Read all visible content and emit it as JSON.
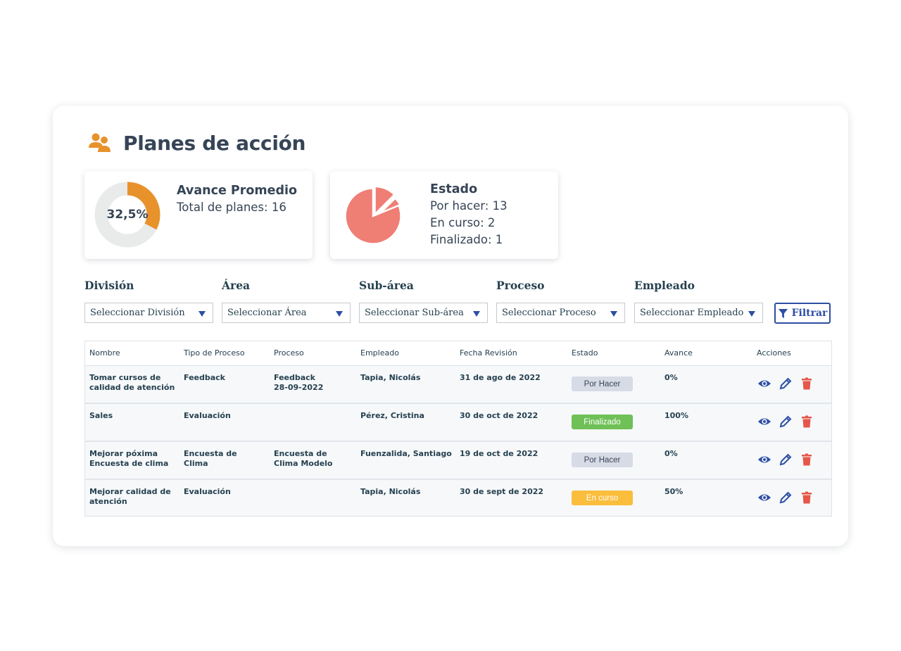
{
  "header": {
    "title": "Planes de acción",
    "icon": "users-icon",
    "accent": "#e8922c"
  },
  "avance": {
    "percent_label": "32,5%",
    "percent": 32.5,
    "title": "Avance Promedio",
    "total": "Total de planes: 16"
  },
  "estado": {
    "title": "Estado",
    "por_hacer": "Por hacer: 13",
    "en_curso": "En curso: 2",
    "finalizado": "Finalizado: 1",
    "counts": {
      "por_hacer": 13,
      "en_curso": 2,
      "finalizado": 1
    },
    "pie_color": "#ef7e74"
  },
  "filters": [
    {
      "label": "División",
      "placeholder": "Seleccionar División"
    },
    {
      "label": "Área",
      "placeholder": "Seleccionar Área"
    },
    {
      "label": "Sub-área",
      "placeholder": "Seleccionar Sub-área"
    },
    {
      "label": "Proceso",
      "placeholder": "Seleccionar Proceso"
    },
    {
      "label": "Empleado",
      "placeholder": "Seleccionar Empleado"
    }
  ],
  "filter_button": "Filtrar",
  "table": {
    "headers": [
      "Nombre",
      "Tipo de Proceso",
      "Proceso",
      "Empleado",
      "Fecha Revisión",
      "Estado",
      "Avance",
      "Acciones"
    ],
    "rows": [
      {
        "nombre_1": "Tomar cursos de",
        "nombre_2": "calidad de atención",
        "tipo_1": "Feedback",
        "tipo_2": "",
        "proceso_1": "Feedback",
        "proceso_2": "28-09-2022",
        "empleado": "Tapia, Nicolás",
        "fecha": "31 de ago de 2022",
        "estado": "Por Hacer",
        "avance": "0%"
      },
      {
        "nombre_1": "Sales",
        "nombre_2": "",
        "tipo_1": "Evaluación",
        "tipo_2": "",
        "proceso_1": "",
        "proceso_2": "",
        "empleado": "Pérez, Cristina",
        "fecha": "30 de oct de 2022",
        "estado": "Finalizado",
        "avance": "100%"
      },
      {
        "nombre_1": "Mejorar póxima",
        "nombre_2": "Encuesta de clima",
        "tipo_1": "Encuesta de",
        "tipo_2": "Clima",
        "proceso_1": "Encuesta de",
        "proceso_2": "Clima Modelo",
        "empleado": "Fuenzalida, Santiago",
        "fecha": "19 de oct de 2022",
        "estado": "Por Hacer",
        "avance": "0%"
      },
      {
        "nombre_1": "Mejorar calidad de",
        "nombre_2": "atención",
        "tipo_1": "Evaluación",
        "tipo_2": "",
        "proceso_1": "",
        "proceso_2": "",
        "empleado": "Tapia, Nicolás",
        "fecha": "30 de sept de 2022",
        "estado": "En curso",
        "avance": "50%"
      }
    ]
  },
  "status_colors": {
    "Por Hacer": "#d6dbe6",
    "Finalizado": "#6fc056",
    "En curso": "#fbbd3c"
  },
  "action_icons": [
    "eye-icon",
    "pencil-icon",
    "trash-icon"
  ],
  "colors": {
    "primary": "#2d4ea3",
    "danger": "#e5574a",
    "text": "#364456"
  }
}
